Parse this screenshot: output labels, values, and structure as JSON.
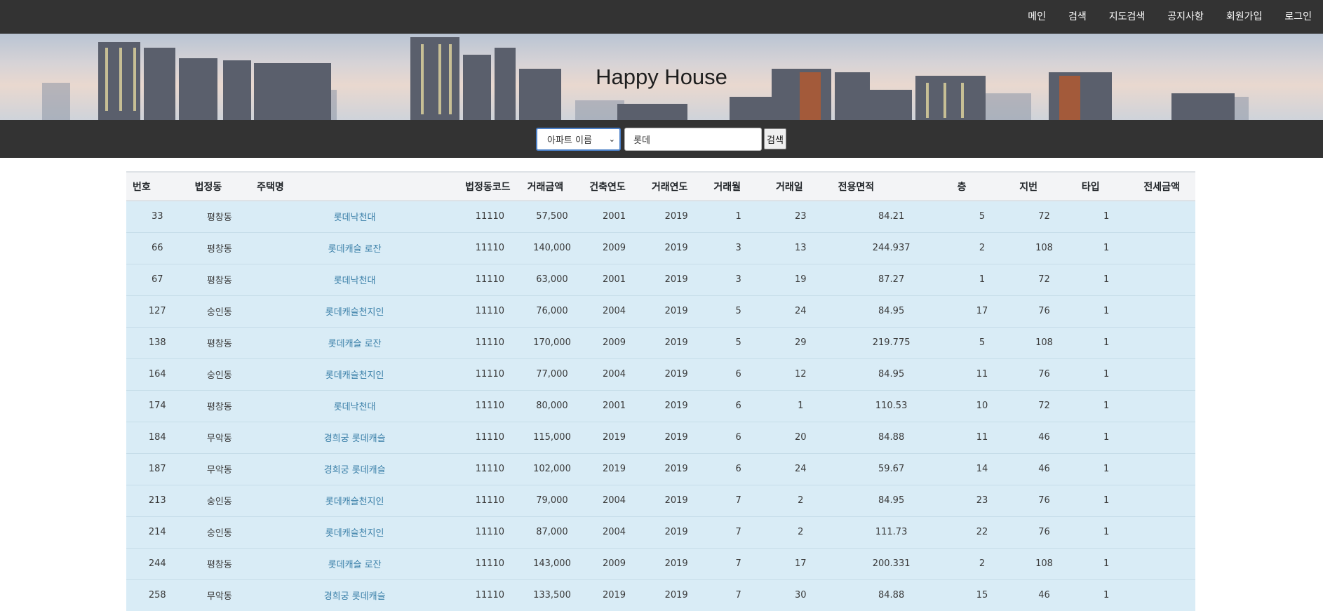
{
  "nav": {
    "items": [
      {
        "label": "메인",
        "name": "nav-main"
      },
      {
        "label": "검색",
        "name": "nav-search"
      },
      {
        "label": "지도검색",
        "name": "nav-map-search"
      },
      {
        "label": "공지사항",
        "name": "nav-notice"
      },
      {
        "label": "회원가입",
        "name": "nav-signup"
      },
      {
        "label": "로그인",
        "name": "nav-login"
      }
    ]
  },
  "banner": {
    "title": "Happy House"
  },
  "search": {
    "select_value": "아파트 이름",
    "input_value": "롯데",
    "button_label": "검색"
  },
  "table": {
    "headers": [
      "번호",
      "법정동",
      "주택명",
      "법정동코드",
      "거래금액",
      "건축연도",
      "거래연도",
      "거래월",
      "거래일",
      "전용면적",
      "층",
      "지번",
      "타입",
      "전세금액"
    ],
    "rows": [
      [
        "33",
        "평창동",
        "롯데낙천대",
        "11110",
        "57,500",
        "2001",
        "2019",
        "1",
        "23",
        "84.21",
        "5",
        "72",
        "1",
        ""
      ],
      [
        "66",
        "평창동",
        "롯데캐슬 로잔",
        "11110",
        "140,000",
        "2009",
        "2019",
        "3",
        "13",
        "244.937",
        "2",
        "108",
        "1",
        ""
      ],
      [
        "67",
        "평창동",
        "롯데낙천대",
        "11110",
        "63,000",
        "2001",
        "2019",
        "3",
        "19",
        "87.27",
        "1",
        "72",
        "1",
        ""
      ],
      [
        "127",
        "숭인동",
        "롯데캐슬천지인",
        "11110",
        "76,000",
        "2004",
        "2019",
        "5",
        "24",
        "84.95",
        "17",
        "76",
        "1",
        ""
      ],
      [
        "138",
        "평창동",
        "롯데캐슬 로잔",
        "11110",
        "170,000",
        "2009",
        "2019",
        "5",
        "29",
        "219.775",
        "5",
        "108",
        "1",
        ""
      ],
      [
        "164",
        "숭인동",
        "롯데캐슬천지인",
        "11110",
        "77,000",
        "2004",
        "2019",
        "6",
        "12",
        "84.95",
        "11",
        "76",
        "1",
        ""
      ],
      [
        "174",
        "평창동",
        "롯데낙천대",
        "11110",
        "80,000",
        "2001",
        "2019",
        "6",
        "1",
        "110.53",
        "10",
        "72",
        "1",
        ""
      ],
      [
        "184",
        "무악동",
        "경희궁 롯데캐슬",
        "11110",
        "115,000",
        "2019",
        "2019",
        "6",
        "20",
        "84.88",
        "11",
        "46",
        "1",
        ""
      ],
      [
        "187",
        "무악동",
        "경희궁 롯데캐슬",
        "11110",
        "102,000",
        "2019",
        "2019",
        "6",
        "24",
        "59.67",
        "14",
        "46",
        "1",
        ""
      ],
      [
        "213",
        "숭인동",
        "롯데캐슬천지인",
        "11110",
        "79,000",
        "2004",
        "2019",
        "7",
        "2",
        "84.95",
        "23",
        "76",
        "1",
        ""
      ],
      [
        "214",
        "숭인동",
        "롯데캐슬천지인",
        "11110",
        "87,000",
        "2004",
        "2019",
        "7",
        "2",
        "111.73",
        "22",
        "76",
        "1",
        ""
      ],
      [
        "244",
        "평창동",
        "롯데캐슬 로잔",
        "11110",
        "143,000",
        "2009",
        "2019",
        "7",
        "17",
        "200.331",
        "2",
        "108",
        "1",
        ""
      ],
      [
        "258",
        "무악동",
        "경희궁 롯데캐슬",
        "11110",
        "133,500",
        "2019",
        "2019",
        "7",
        "30",
        "84.88",
        "15",
        "46",
        "1",
        ""
      ]
    ]
  }
}
